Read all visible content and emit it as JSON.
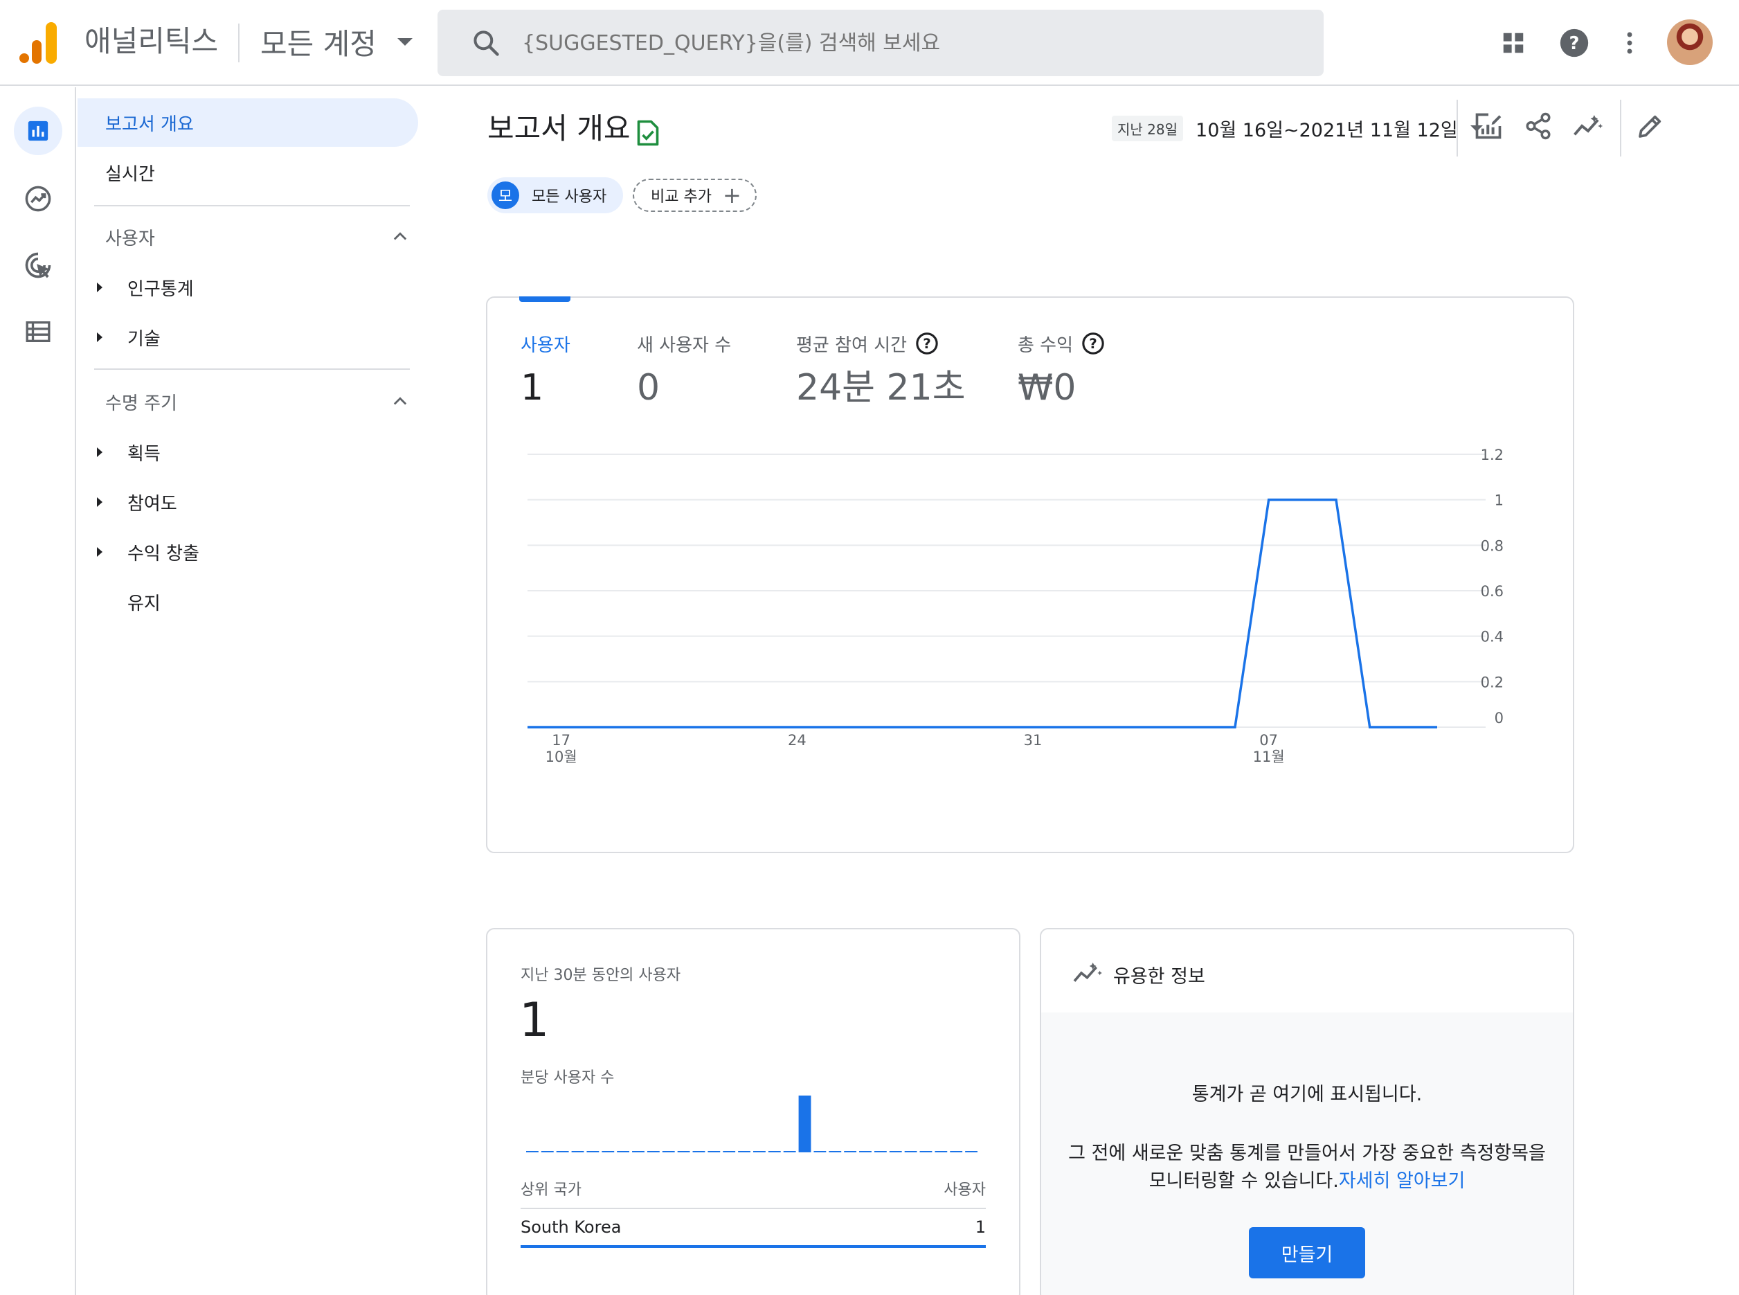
{
  "header": {
    "app_title": "애널리틱스",
    "account_label": "모든 계정",
    "search_placeholder": "{SUGGESTED_QUERY}을(를) 검색해 보세요",
    "icons": [
      "apps-grid-icon",
      "help-icon",
      "more-vert-icon",
      "avatar"
    ]
  },
  "rail": {
    "items": [
      "reports-icon",
      "explore-icon",
      "advertising-icon",
      "configure-icon"
    ]
  },
  "sidebar": {
    "overview": "보고서 개요",
    "realtime": "실시간",
    "user_section": "사용자",
    "user_items": [
      "인구통계",
      "기술"
    ],
    "lifecycle_section": "수명 주기",
    "lifecycle_items": [
      "획득",
      "참여도",
      "수익 창출",
      "유지"
    ]
  },
  "main": {
    "title": "보고서 개요",
    "date_prefix": "지난 28일",
    "date_range": "10월 16일~2021년 11월 12일",
    "actions": [
      "customize-report-icon",
      "share-icon",
      "insights-icon",
      "edit-icon"
    ],
    "chips": {
      "badge": "모",
      "segment": "모든 사용자",
      "add_compare": "비교 추가"
    }
  },
  "metrics": [
    {
      "label": "사용자",
      "value": "1",
      "selected": true
    },
    {
      "label": "새 사용자 수",
      "value": "0"
    },
    {
      "label": "평균 참여 시간",
      "value": "24분 21초",
      "help": true
    },
    {
      "label": "총 수익",
      "value": "₩0",
      "help": true
    }
  ],
  "chart_data": {
    "type": "line",
    "x_tick_labels": [
      {
        "day": "17",
        "month": "10월"
      },
      {
        "day": "24",
        "month": ""
      },
      {
        "day": "31",
        "month": ""
      },
      {
        "day": "07",
        "month": "11월"
      }
    ],
    "y_tick_labels": [
      "1.2",
      "1",
      "0.8",
      "0.6",
      "0.4",
      "0.2",
      "0"
    ],
    "ylim": [
      0,
      1.2
    ],
    "grid": true,
    "series": [
      {
        "color": "#1a73e8",
        "x": [
          "10-16",
          "10-17",
          "10-18",
          "10-19",
          "10-20",
          "10-21",
          "10-22",
          "10-23",
          "10-24",
          "10-25",
          "10-26",
          "10-27",
          "10-28",
          "10-29",
          "10-30",
          "10-31",
          "11-01",
          "11-02",
          "11-03",
          "11-04",
          "11-05",
          "11-06",
          "11-07",
          "11-08",
          "11-09",
          "11-10",
          "11-11",
          "11-12"
        ],
        "values": [
          0,
          0,
          0,
          0,
          0,
          0,
          0,
          0,
          0,
          0,
          0,
          0,
          0,
          0,
          0,
          0,
          0,
          0,
          0,
          0,
          0,
          0,
          1,
          1,
          1,
          0,
          0,
          0
        ]
      }
    ]
  },
  "realtime": {
    "title": "지난 30분 동안의 사용자",
    "value": "1",
    "per_minute_label": "분당 사용자 수",
    "bars": [
      0,
      0,
      0,
      0,
      0,
      0,
      0,
      0,
      0,
      0,
      0,
      0,
      0,
      0,
      0,
      0,
      0,
      0,
      1,
      0,
      0,
      0,
      0,
      0,
      0,
      0,
      0,
      0,
      0,
      0
    ],
    "country_header": "상위 국가",
    "users_header": "사용자",
    "rows": [
      {
        "country": "South Korea",
        "users": "1"
      }
    ]
  },
  "insights": {
    "title": "유용한 정보",
    "message": "통계가 곧 여기에 표시됩니다.",
    "description": "그 전에 새로운 맞춤 통계를 만들어서 가장 중요한 측정항목을 모니터링할 수 있습니다.",
    "link": "자세히 알아보기",
    "create_button": "만들기"
  },
  "colors": {
    "accent": "#1a73e8",
    "logo_orange": "#f9ab00",
    "logo_dark_orange": "#e37400",
    "success": "#1e8e3e"
  }
}
